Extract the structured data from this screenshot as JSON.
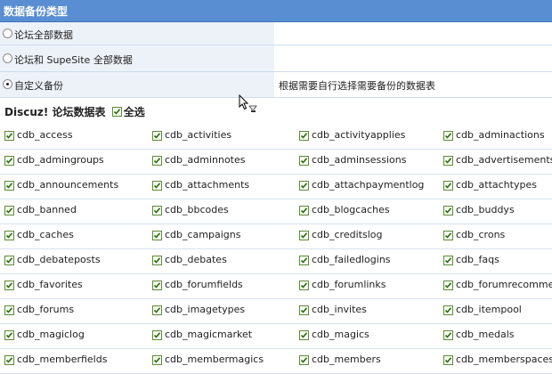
{
  "header": {
    "title": "数据备份类型"
  },
  "options": [
    {
      "label": "论坛全部数据",
      "checked": false,
      "desc": ""
    },
    {
      "label": "论坛和 SupeSite 全部数据",
      "checked": false,
      "desc": ""
    },
    {
      "label": "自定义备份",
      "checked": true,
      "desc": "根据需要自行选择需要备份的数据表"
    }
  ],
  "tables_section": {
    "title": "Discuz! 论坛数据表",
    "select_all_label": "全选"
  },
  "tables": [
    [
      "cdb_access",
      "cdb_activities",
      "cdb_activityapplies",
      "cdb_adminactions"
    ],
    [
      "cdb_admingroups",
      "cdb_adminnotes",
      "cdb_adminsessions",
      "cdb_advertisements"
    ],
    [
      "cdb_announcements",
      "cdb_attachments",
      "cdb_attachpaymentlog",
      "cdb_attachtypes"
    ],
    [
      "cdb_banned",
      "cdb_bbcodes",
      "cdb_blogcaches",
      "cdb_buddys"
    ],
    [
      "cdb_caches",
      "cdb_campaigns",
      "cdb_creditslog",
      "cdb_crons"
    ],
    [
      "cdb_debateposts",
      "cdb_debates",
      "cdb_failedlogins",
      "cdb_faqs"
    ],
    [
      "cdb_favorites",
      "cdb_forumfields",
      "cdb_forumlinks",
      "cdb_forumrecommend"
    ],
    [
      "cdb_forums",
      "cdb_imagetypes",
      "cdb_invites",
      "cdb_itempool"
    ],
    [
      "cdb_magiclog",
      "cdb_magicmarket",
      "cdb_magics",
      "cdb_medals"
    ],
    [
      "cdb_memberfields",
      "cdb_membermagics",
      "cdb_members",
      "cdb_memberspaces"
    ]
  ]
}
